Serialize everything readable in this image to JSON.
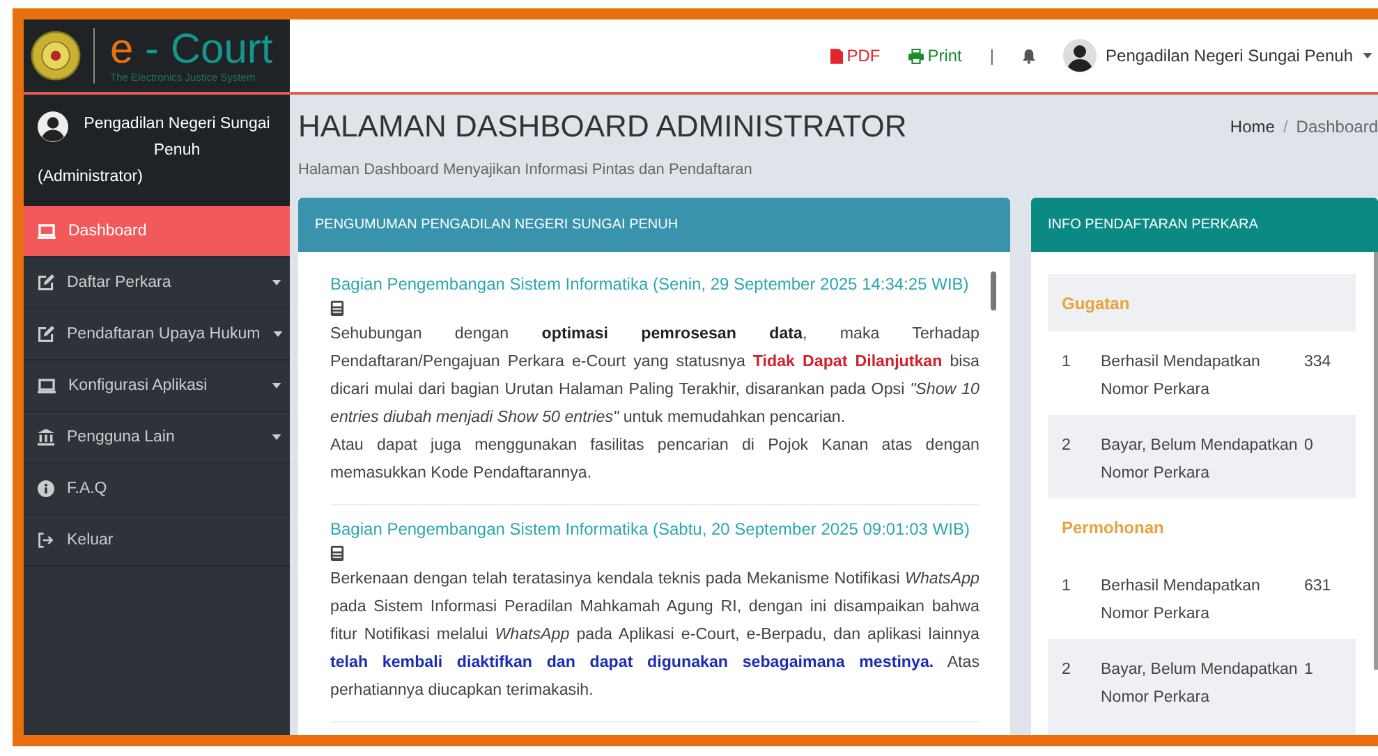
{
  "logo": {
    "title_prefix": "e",
    "title_rest": " - Court",
    "tagline": "The Electronics Justice System"
  },
  "topbar": {
    "pdf": "PDF",
    "print": "Print",
    "separator": "|",
    "user": "Pengadilan Negeri Sungai Penuh"
  },
  "sidebar": {
    "user_name": "Pengadilan Negeri Sungai Penuh",
    "user_role": "(Administrator)",
    "items": [
      {
        "label": "Dashboard",
        "selected": true,
        "has_caret": false
      },
      {
        "label": "Daftar Perkara",
        "selected": false,
        "has_caret": true
      },
      {
        "label": "Pendaftaran Upaya Hukum",
        "selected": false,
        "has_caret": true
      },
      {
        "label": "Konfigurasi Aplikasi",
        "selected": false,
        "has_caret": true
      },
      {
        "label": "Pengguna Lain",
        "selected": false,
        "has_caret": true
      },
      {
        "label": "F.A.Q",
        "selected": false,
        "has_caret": false
      },
      {
        "label": "Keluar",
        "selected": false,
        "has_caret": false
      }
    ]
  },
  "page": {
    "title": "HALAMAN DASHBOARD ADMINISTRATOR",
    "subtitle": "Halaman Dashboard Menyajikan Informasi Pintas dan Pendaftaran",
    "breadcrumb": {
      "items": [
        "Home",
        "Dashboard"
      ],
      "separator": "/"
    }
  },
  "announcements": {
    "title": "PENGUMUMAN PENGADILAN NEGERI SUNGAI PENUH",
    "items": [
      {
        "heading": "Bagian Pengembangan Sistem Informatika (Senin, 29 September 2025 14:34:25 WIB)",
        "paragraphs": [
          [
            {
              "kind": "plain",
              "text": "Sehubungan dengan "
            },
            {
              "kind": "bold",
              "text": "optimasi pemrosesan data"
            },
            {
              "kind": "plain",
              "text": ", maka Terhadap Pendaftaran/Pengajuan Perkara e-Court yang statusnya "
            },
            {
              "kind": "red",
              "text": "Tidak Dapat Dilanjutkan"
            },
            {
              "kind": "plain",
              "text": " bisa dicari mulai dari bagian Urutan Halaman Paling Terakhir, disarankan pada Opsi "
            },
            {
              "kind": "italic",
              "text": "\"Show 10 entries diubah menjadi Show 50 entries\""
            },
            {
              "kind": "plain",
              "text": " untuk memudahkan pencarian."
            }
          ],
          [
            {
              "kind": "plain",
              "text": "Atau dapat juga menggunakan fasilitas pencarian di Pojok Kanan atas dengan memasukkan Kode Pendaftarannya."
            }
          ]
        ]
      },
      {
        "heading": "Bagian Pengembangan Sistem Informatika (Sabtu, 20 September 2025 09:01:03 WIB)",
        "paragraphs": [
          [
            {
              "kind": "plain",
              "text": "Berkenaan dengan telah teratasinya kendala teknis pada Mekanisme Notifikasi "
            },
            {
              "kind": "italic",
              "text": "WhatsApp"
            },
            {
              "kind": "plain",
              "text": " pada Sistem Informasi Peradilan Mahkamah Agung RI, dengan ini disampaikan bahwa fitur Notifikasi melalui "
            },
            {
              "kind": "italic",
              "text": "WhatsApp"
            },
            {
              "kind": "plain",
              "text": " pada Aplikasi e-Court, e-Berpadu, dan aplikasi lainnya "
            },
            {
              "kind": "blue",
              "text": "telah kembali diaktifkan dan dapat digunakan sebagaimana mestinya."
            },
            {
              "kind": "plain",
              "text": " Atas perhatiannya diucapkan terimakasih."
            }
          ]
        ]
      }
    ]
  },
  "info": {
    "title": "INFO PENDAFTARAN PERKARA",
    "sections": [
      {
        "title": "Gugatan",
        "rows": [
          {
            "no": "1",
            "label": "Berhasil Mendapatkan Nomor Perkara",
            "count": "334"
          },
          {
            "no": "2",
            "label": "Bayar, Belum Mendapatkan Nomor Perkara",
            "count": "0"
          }
        ]
      },
      {
        "title": "Permohonan",
        "rows": [
          {
            "no": "1",
            "label": "Berhasil Mendapatkan Nomor Perkara",
            "count": "631"
          },
          {
            "no": "2",
            "label": "Bayar, Belum Mendapatkan Nomor Perkara",
            "count": "1"
          }
        ]
      }
    ]
  }
}
